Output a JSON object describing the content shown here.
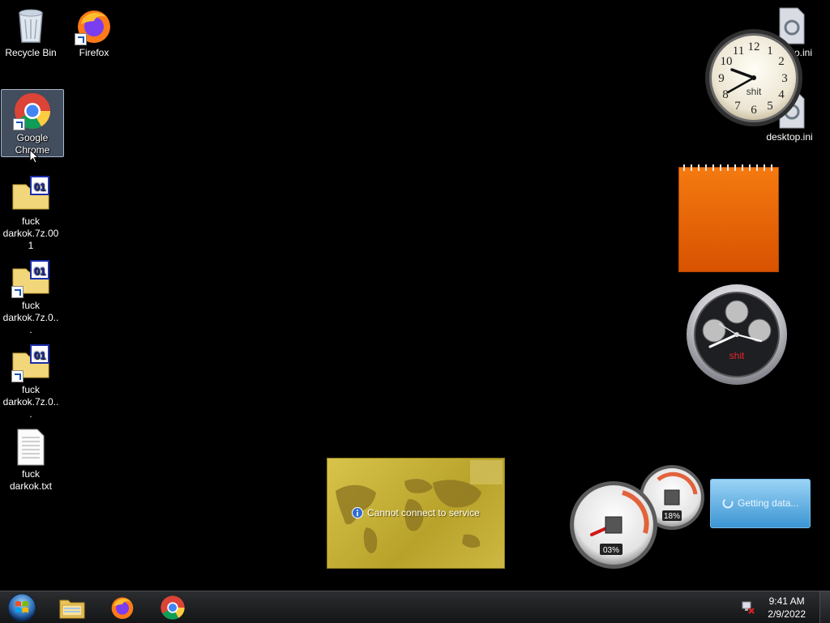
{
  "desktop_icons": [
    {
      "label": "Recycle Bin",
      "icon": "recycle-bin-icon"
    },
    {
      "label": "Firefox",
      "icon": "firefox-icon"
    },
    {
      "label": "Google Chrome",
      "icon": "chrome-icon"
    },
    {
      "label": "fuck darkok.7z.001",
      "icon": "archive-file-icon"
    },
    {
      "label": "fuck darkok.7z.0...",
      "icon": "archive-file-icon"
    },
    {
      "label": "fuck darkok.7z.0...",
      "icon": "archive-file-icon"
    },
    {
      "label": "fuck darkok.txt",
      "icon": "text-file-icon"
    },
    {
      "label": "...o.ini",
      "icon": "settings-file-icon"
    },
    {
      "label": "desktop.ini",
      "icon": "settings-file-icon"
    }
  ],
  "gadgets": {
    "clock": {
      "label": "shit",
      "numerals": [
        "12",
        "1",
        "2",
        "3",
        "4",
        "5",
        "6",
        "7",
        "8",
        "9",
        "10",
        "11"
      ]
    },
    "chrono_clock": {
      "label": "shit"
    },
    "currency": {
      "message": "Cannot connect to service"
    },
    "cpu_meter": {
      "cpu_value": "03%",
      "ram_value": "18%"
    },
    "weather": {
      "message": "Getting data..."
    }
  },
  "taskbar": {
    "time": "9:41 AM",
    "date": "2/9/2022",
    "pinned": [
      "file-explorer-icon",
      "firefox-icon",
      "chrome-icon"
    ]
  },
  "colors": {
    "desktop_bg": "#000000",
    "notepad": "#f06a0a",
    "selection": "#7b8cab"
  }
}
